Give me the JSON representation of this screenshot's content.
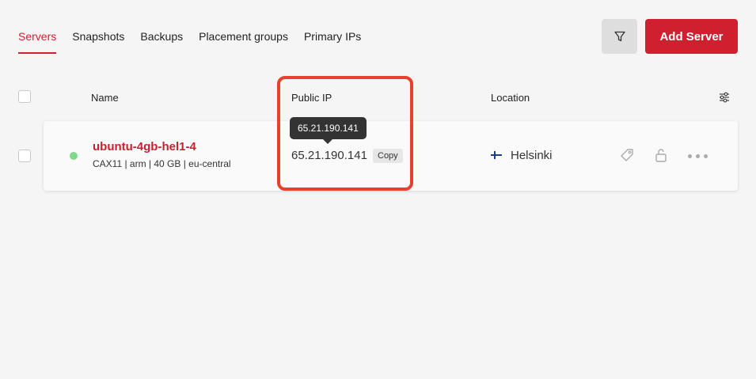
{
  "tabs": [
    {
      "label": "Servers",
      "active": true
    },
    {
      "label": "Snapshots",
      "active": false
    },
    {
      "label": "Backups",
      "active": false
    },
    {
      "label": "Placement groups",
      "active": false
    },
    {
      "label": "Primary IPs",
      "active": false
    }
  ],
  "toolbar": {
    "filter_icon": "filter-icon",
    "add_server_label": "Add Server"
  },
  "table": {
    "columns": {
      "name": "Name",
      "public_ip": "Public IP",
      "location": "Location"
    },
    "rows": [
      {
        "status": "running",
        "status_color": "#7fd98a",
        "name": "ubuntu-4gb-hel1-4",
        "meta": "CAX11 | arm | 40 GB | eu-central",
        "public_ip": "65.21.190.141",
        "copy_label": "Copy",
        "tooltip": "65.21.190.141",
        "location": "Helsinki",
        "location_flag": "finland-flag-icon"
      }
    ]
  },
  "colors": {
    "accent": "#d0202f",
    "highlight": "#e5412d",
    "background": "#f5f5f5"
  }
}
